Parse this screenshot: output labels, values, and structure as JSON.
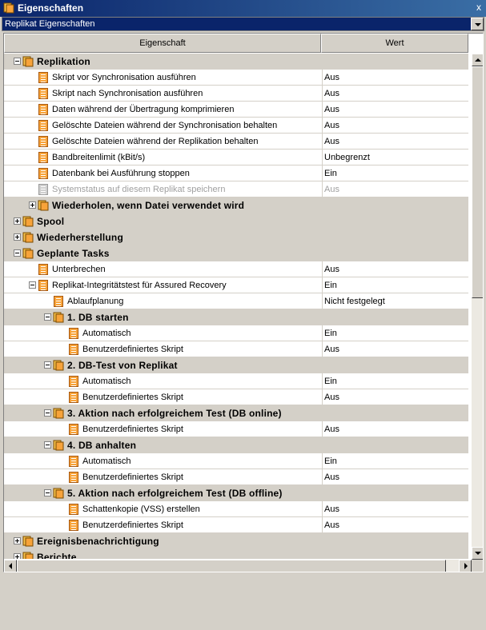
{
  "window": {
    "title": "Eigenschaften",
    "close_glyph": "x"
  },
  "selector": {
    "value": "Replikat  Eigenschaften"
  },
  "table": {
    "columns": [
      "Eigenschaft",
      "Wert"
    ],
    "rows": [
      {
        "type": "section",
        "depth": 0,
        "toggle": "minus",
        "label": "Replikation",
        "value": ""
      },
      {
        "type": "prop",
        "depth": 1,
        "label": "Skript vor Synchronisation ausführen",
        "value": "Aus"
      },
      {
        "type": "prop",
        "depth": 1,
        "label": "Skript nach Synchronisation ausführen",
        "value": "Aus"
      },
      {
        "type": "prop",
        "depth": 1,
        "label": "Daten während der Übertragung komprimieren",
        "value": "Aus"
      },
      {
        "type": "prop",
        "depth": 1,
        "label": "Gelöschte Dateien während der Synchronisation behalten",
        "value": "Aus"
      },
      {
        "type": "prop",
        "depth": 1,
        "label": "Gelöschte Dateien während der Replikation behalten",
        "value": "Aus"
      },
      {
        "type": "prop",
        "depth": 1,
        "label": "Bandbreitenlimit (kBit/s)",
        "value": "Unbegrenzt"
      },
      {
        "type": "prop",
        "depth": 1,
        "label": "Datenbank bei Ausführung stoppen",
        "value": "Ein"
      },
      {
        "type": "prop",
        "depth": 1,
        "label": "Systemstatus auf diesem Replikat speichern",
        "value": "Aus",
        "disabled": true
      },
      {
        "type": "section",
        "depth": 1,
        "toggle": "plus",
        "label": "Wiederholen, wenn Datei verwendet wird",
        "value": ""
      },
      {
        "type": "section",
        "depth": 0,
        "toggle": "plus",
        "label": "Spool",
        "value": ""
      },
      {
        "type": "section",
        "depth": 0,
        "toggle": "plus",
        "label": "Wiederherstellung",
        "value": ""
      },
      {
        "type": "section",
        "depth": 0,
        "toggle": "minus",
        "label": "Geplante Tasks",
        "value": ""
      },
      {
        "type": "prop",
        "depth": 1,
        "label": "Unterbrechen",
        "value": "Aus"
      },
      {
        "type": "prop",
        "depth": 1,
        "toggle": "minus",
        "label": "Replikat-Integritätstest für Assured Recovery",
        "value": "Ein"
      },
      {
        "type": "prop",
        "depth": 2,
        "label": "Ablaufplanung",
        "value": "Nicht festgelegt"
      },
      {
        "type": "section",
        "depth": 2,
        "toggle": "minus",
        "label": "1. DB starten",
        "value": ""
      },
      {
        "type": "prop",
        "depth": 3,
        "label": "Automatisch",
        "value": "Ein"
      },
      {
        "type": "prop",
        "depth": 3,
        "label": "Benutzerdefiniertes Skript",
        "value": "Aus"
      },
      {
        "type": "section",
        "depth": 2,
        "toggle": "minus",
        "label": "2. DB-Test von Replikat",
        "value": ""
      },
      {
        "type": "prop",
        "depth": 3,
        "label": "Automatisch",
        "value": "Ein"
      },
      {
        "type": "prop",
        "depth": 3,
        "label": "Benutzerdefiniertes Skript",
        "value": "Aus"
      },
      {
        "type": "section",
        "depth": 2,
        "toggle": "minus",
        "label": "3. Aktion nach erfolgreichem Test (DB online)",
        "value": ""
      },
      {
        "type": "prop",
        "depth": 3,
        "label": "Benutzerdefiniertes Skript",
        "value": "Aus"
      },
      {
        "type": "section",
        "depth": 2,
        "toggle": "minus",
        "label": "4. DB anhalten",
        "value": ""
      },
      {
        "type": "prop",
        "depth": 3,
        "label": "Automatisch",
        "value": "Ein"
      },
      {
        "type": "prop",
        "depth": 3,
        "label": "Benutzerdefiniertes Skript",
        "value": "Aus"
      },
      {
        "type": "section",
        "depth": 2,
        "toggle": "minus",
        "label": "5. Aktion nach erfolgreichem Test (DB offline)",
        "value": ""
      },
      {
        "type": "prop",
        "depth": 3,
        "label": "Schattenkopie (VSS) erstellen",
        "value": "Aus"
      },
      {
        "type": "prop",
        "depth": 3,
        "label": "Benutzerdefiniertes Skript",
        "value": "Aus"
      },
      {
        "type": "section",
        "depth": 0,
        "toggle": "plus",
        "label": "Ereignisbenachrichtigung",
        "value": ""
      },
      {
        "type": "section",
        "depth": 0,
        "toggle": "plus",
        "label": "Berichte",
        "value": ""
      }
    ]
  },
  "colors": {
    "titlebar": "#0a246a",
    "property_icon": "#f7a33a",
    "section_background": "#d4d0c8"
  }
}
